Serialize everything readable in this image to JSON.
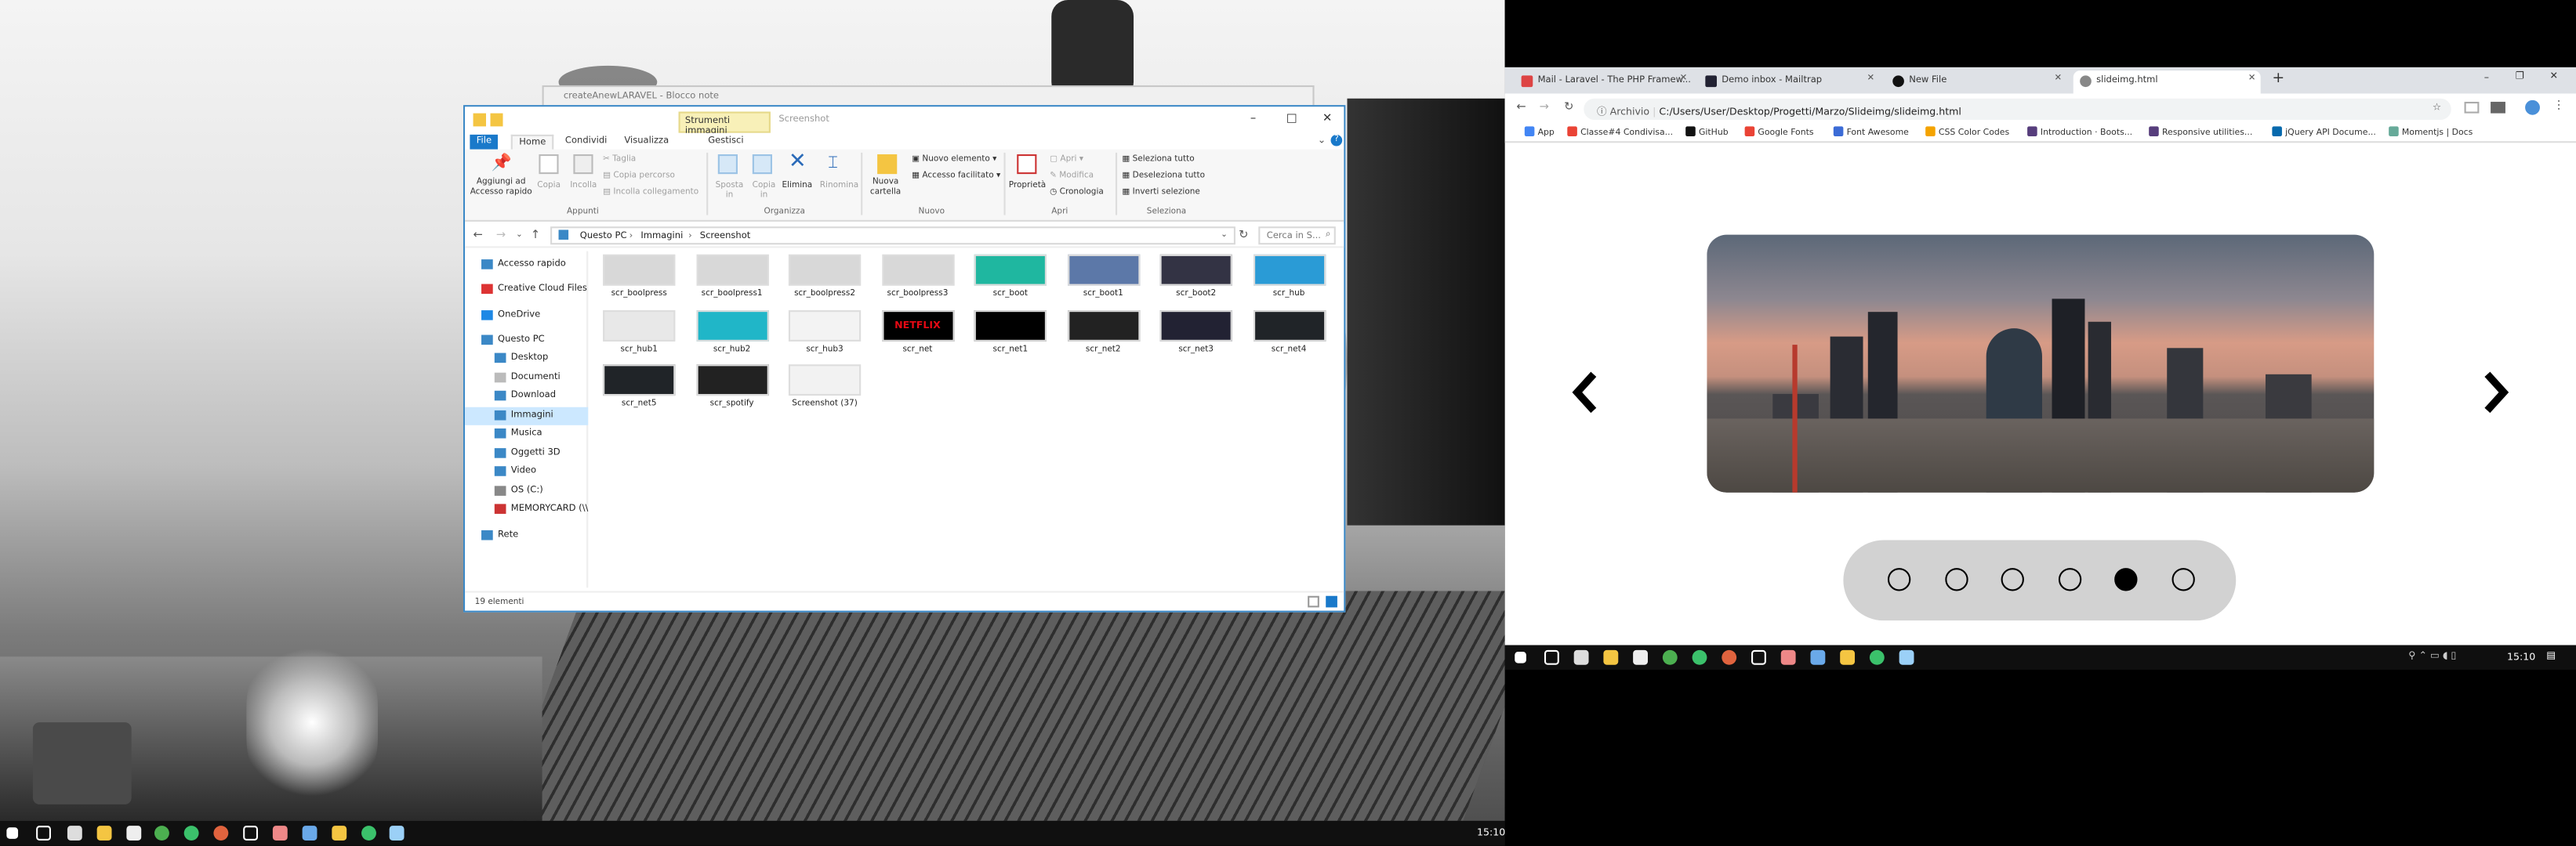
{
  "left_monitor": {
    "notepad_title": "createAnewLARAVEL - Blocco note",
    "taskbar": {
      "clock": "15:10"
    }
  },
  "explorer": {
    "tools_tab": "Strumenti immagini",
    "window_title": "Screenshot",
    "manage_tab": "Gestisci",
    "ribbon_tabs": [
      "File",
      "Home",
      "Condividi",
      "Visualizza"
    ],
    "groups": {
      "clipboard": {
        "name": "Appunti",
        "pin": "Aggiungi ad Accesso rapido",
        "copy": "Copia",
        "paste": "Incolla",
        "cut": "Taglia",
        "copy_path": "Copia percorso",
        "paste_shortcut": "Incolla collegamento"
      },
      "organize": {
        "name": "Organizza",
        "move": "Sposta in",
        "copy_to": "Copia in",
        "delete": "Elimina",
        "rename": "Rinomina"
      },
      "new": {
        "name": "Nuovo",
        "folder": "Nuova cartella",
        "item": "Nuovo elemento",
        "easy": "Accesso facilitato"
      },
      "open": {
        "name": "Apri",
        "props": "Proprietà",
        "open": "Apri",
        "edit": "Modifica",
        "history": "Cronologia"
      },
      "select": {
        "name": "Seleziona",
        "all": "Seleziona tutto",
        "none": "Deseleziona tutto",
        "invert": "Inverti selezione"
      }
    },
    "breadcrumb": [
      "Questo PC",
      "Immagini",
      "Screenshot"
    ],
    "search_placeholder": "Cerca in S...",
    "nav": [
      "Accesso rapido",
      "Creative Cloud Files",
      "OneDrive",
      "Questo PC",
      "Desktop",
      "Documenti",
      "Download",
      "Immagini",
      "Musica",
      "Oggetti 3D",
      "Video",
      "OS (C:)",
      "MEMORYCARD (\\\\E",
      "Rete"
    ],
    "files": [
      "scr_boolpress",
      "scr_boolpress1",
      "scr_boolpress2",
      "scr_boolpress3",
      "scr_boot",
      "scr_boot1",
      "scr_boot2",
      "scr_hub",
      "scr_hub1",
      "scr_hub2",
      "scr_hub3",
      "scr_net",
      "scr_net1",
      "scr_net2",
      "scr_net3",
      "scr_net4",
      "scr_net5",
      "scr_spotify",
      "Screenshot (37)"
    ],
    "netflix_label": "NETFLIX",
    "status": "19 elementi"
  },
  "browser": {
    "tabs": [
      "Mail - Laravel - The PHP Framew...",
      "Demo inbox - Mailtrap",
      "New File",
      "slideimg.html"
    ],
    "new_tab": "+",
    "address_label": "Archivio",
    "url": "C:/Users/User/Desktop/Progetti/Marzo/Slideimg/slideimg.html",
    "bookmarks": [
      "App",
      "Classe#4 Condivisa...",
      "GitHub",
      "Google Fonts",
      "Font Awesome",
      "CSS Color Codes",
      "Introduction · Boots...",
      "Responsive utilities...",
      "jQuery API Docume...",
      "Momentjs | Docs"
    ],
    "prev": "‹",
    "next": "›",
    "dots": {
      "count": 6,
      "active_index": 4
    }
  },
  "right_taskbar": {
    "clock": "15:10"
  }
}
